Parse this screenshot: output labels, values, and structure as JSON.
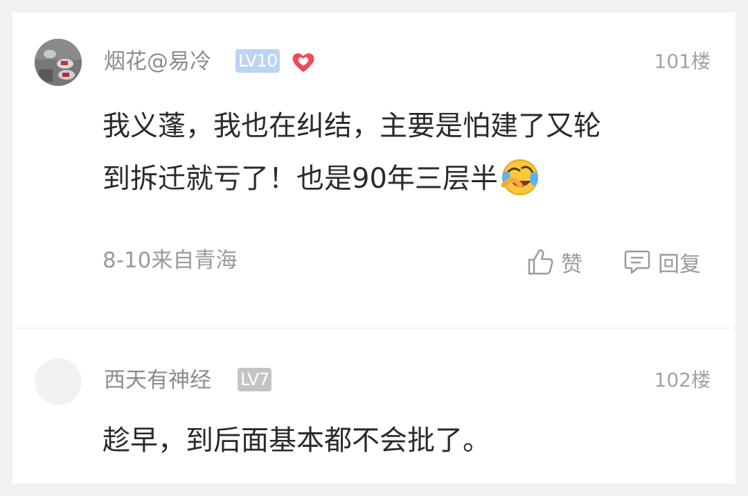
{
  "comments": [
    {
      "username": "烟花@易冷",
      "level": "LV10",
      "floor": "101楼",
      "content_line1": "我义蓬，我也在纠结，主要是怕建了又轮",
      "content_line2": "到拆迁就亏了！也是90年三层半",
      "emoji": "laughing-crying-emoji",
      "meta": "8-10来自青海",
      "like_label": "赞",
      "reply_label": "回复"
    },
    {
      "username": "西天有神经",
      "level": "LV7",
      "floor": "102楼",
      "content_line1": "趁早，到后面基本都不会批了。"
    }
  ],
  "colors": {
    "background": "#f1f1f1",
    "card": "#ffffff",
    "text": "#2a2a2a",
    "muted": "#8c8c8c",
    "level_blue": "#bdd3f4",
    "level_gray": "#c4c4c4",
    "heart": "#f04a55"
  }
}
